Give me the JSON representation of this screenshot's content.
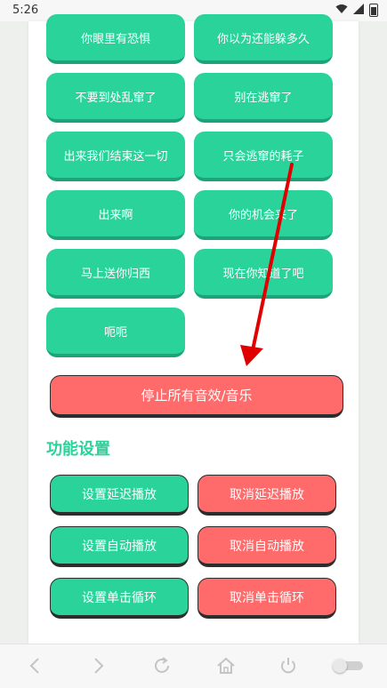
{
  "status_bar": {
    "time": "5:26",
    "icons": [
      "wifi-icon",
      "signal-icon",
      "battery-icon"
    ]
  },
  "sound_buttons": [
    {
      "label": "你眼里有恐惧"
    },
    {
      "label": "你以为还能躲多久"
    },
    {
      "label": "不要到处乱窜了"
    },
    {
      "label": "别在逃窜了"
    },
    {
      "label": "出来我们结束这一切"
    },
    {
      "label": "只会逃窜的耗子"
    },
    {
      "label": "出来啊"
    },
    {
      "label": "你的机会来了"
    },
    {
      "label": "马上送你归西"
    },
    {
      "label": "现在你知道了吧"
    },
    {
      "label": "呃呃"
    }
  ],
  "stop_button": {
    "label": "停止所有音效/音乐"
  },
  "settings": {
    "title": "功能设置",
    "buttons": [
      {
        "label": "设置延迟播放",
        "color": "green"
      },
      {
        "label": "取消延迟播放",
        "color": "red"
      },
      {
        "label": "设置自动播放",
        "color": "green"
      },
      {
        "label": "取消自动播放",
        "color": "red"
      },
      {
        "label": "设置单击循环",
        "color": "green"
      },
      {
        "label": "取消单击循环",
        "color": "red"
      }
    ]
  },
  "nav_bar": {
    "icons": [
      "back-icon",
      "forward-icon",
      "refresh-icon",
      "home-icon",
      "power-icon",
      "toggle-switch"
    ]
  },
  "colors": {
    "accent_green": "#2ad39a",
    "accent_red": "#ff6b6b",
    "annotation_arrow": "#e00000"
  }
}
